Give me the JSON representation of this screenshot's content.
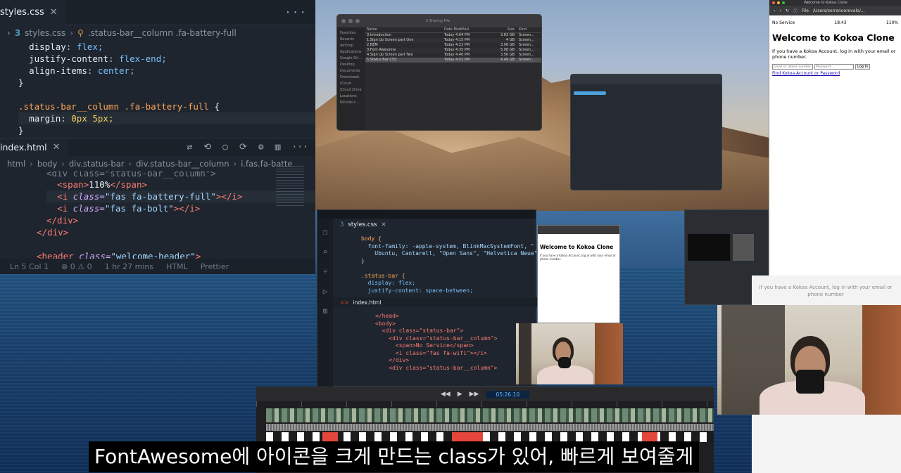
{
  "main_editor": {
    "css_tab": {
      "name": "styles.css",
      "close": "✕"
    },
    "more": "···",
    "css_breadcrumb": {
      "file": "styles.css",
      "selector": ".status-bar__column .fa-battery-full"
    },
    "css_lines": [
      {
        "prop": "display",
        "val": "flex;"
      },
      {
        "prop": "justify-content",
        "val": "flex-end;"
      },
      {
        "prop": "align-items",
        "val": "center;"
      }
    ],
    "close_brace": "}",
    "rule_selector": ".status-bar__column .fa-battery-full",
    "open_brace": "{",
    "margin_prop": "margin",
    "margin_val": "0px 5px;",
    "html_tab": {
      "name": "index.html",
      "close": "✕"
    },
    "html_breadcrumb": [
      "html",
      "body",
      "div.status-bar",
      "div.status-bar__column",
      "i.fas.fa-batte"
    ],
    "html_lines": {
      "div_partial": "<div class=\"status-bar__column\">",
      "span_open": "<span>",
      "span_text": "110%",
      "span_close": "</span>",
      "i1_open": "<i",
      "i1_class_attr": "class=",
      "i1_class_val": "\"fas fa-battery-full\"",
      "i1_close": "></i>",
      "i2_open": "<i",
      "i2_class_attr": "class=",
      "i2_class_val": "\"fas fa-bolt\"",
      "i2_close": "></i>",
      "div_close": "</div>",
      "div_close2": "</div>",
      "header_open": "<header",
      "header_attr": "class=",
      "header_val": "\"welcome-header\"",
      "header_end": ">"
    },
    "status": {
      "ln": "Ln 5 Col 1",
      "errors": "⊗ 0 ⚠ 0",
      "time": "1 hr 27 mins",
      "lang": "HTML",
      "prettier": "Prettier"
    }
  },
  "finder": {
    "title": "5 Sharing File",
    "sidebar": [
      "Favorites",
      "Recents",
      "AirDrop",
      "Applications",
      "Google Dri...",
      "Desktop",
      "Documents",
      "Downloads",
      "iCloud",
      "iCloud Drive",
      "Locations",
      "Nicolás's ..."
    ],
    "columns": [
      "Name",
      "Date Modified",
      "Size",
      "Kind"
    ],
    "rows": [
      {
        "name": "0.Introduction",
        "date": "Today 4:04 PM",
        "size": "3.83 GB",
        "kind": "Screen..."
      },
      {
        "name": "1.Sign Up Screen part One",
        "date": "Today 4:15 PM",
        "size": "4 GB",
        "kind": "Screen..."
      },
      {
        "name": "2.BEM",
        "date": "Today 4:22 PM",
        "size": "3.08 GB",
        "kind": "Screen..."
      },
      {
        "name": "3.Font Awesome",
        "date": "Today 4:35 PM",
        "size": "5.08 GB",
        "kind": "Screen..."
      },
      {
        "name": "4.Sign Up Screen part Two",
        "date": "Today 4:40 PM",
        "size": "3.56 GB",
        "kind": "Screen..."
      },
      {
        "name": "5.Status Bar CSS",
        "date": "Today 4:52 PM",
        "size": "4.49 GB",
        "kind": "Screen..."
      }
    ]
  },
  "browser": {
    "tab_title": "Welcome to Kokoa Clone",
    "url": "/Users/serranoarevalo/...",
    "file_label": "File",
    "phone_status": {
      "left": "No Service",
      "time": "18:43",
      "right": "110%"
    },
    "heading": "Welcome to Kokoa Clone",
    "paragraph": "If you have a Kokoa Account, log in with your email or phone number.",
    "email_placeholder": "Email or phone number",
    "password_placeholder": "Password",
    "login_button": "Log In",
    "find_link": "Find Kokoa Account or Password"
  },
  "editor2": {
    "css_tab": "styles.css",
    "lines": [
      "body {",
      "  font-family: -apple-system, BlinkMacSystemFont, \"",
      "    Ubuntu, Cantarell, \"Open Sans\", \"Helvetica Neue\"",
      "}",
      "",
      ".status-bar {",
      "  display: flex;",
      "  justify-content: space-between;"
    ],
    "html_tab": "index.html",
    "html_lines": [
      "</head>",
      "<body>",
      "  <div class=\"status-bar\">",
      "    <div class=\"status-bar__column\">",
      "      <span>No Service</span>",
      "      <i class=\"fas fa-wifi\"></i>",
      "    </div>",
      "    <div class=\"status-bar__column\">"
    ]
  },
  "mini_browser": {
    "heading": "Welcome to Kokoa Clone",
    "paragraph": "If you have a Kokoa Account, log in with your email or phone number."
  },
  "white_panel": {
    "text": "If you have a Kokoa Account, log in with your email or phone number"
  },
  "timeline": {
    "time": "05:26:10"
  },
  "subtitle": {
    "text": "FontAwesome에 아이콘을 크게 만드는 class가 있어, 빠르게 보여줄게"
  }
}
